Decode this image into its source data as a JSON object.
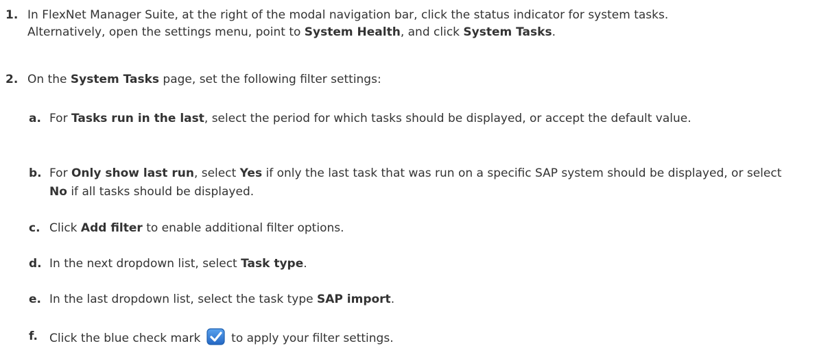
{
  "steps": [
    {
      "number": "1.",
      "line1": "In FlexNet Manager Suite, at the right of the modal navigation bar, click the status indicator for system tasks.",
      "line2_before": "Alternatively, open the settings menu, point to ",
      "system_health": "System Health",
      "line2_middle": ", and click ",
      "system_tasks": "System Tasks",
      "line2_end": "."
    },
    {
      "number": "2.",
      "before": "On the ",
      "system_tasks": "System Tasks",
      "after": " page, set the following filter settings:"
    }
  ],
  "substeps": {
    "a": {
      "letter": "a.",
      "before": "For ",
      "bold1": "Tasks run in the last",
      "after": ", select the period for which tasks should be displayed, or accept the default value."
    },
    "b": {
      "letter": "b.",
      "before": "For ",
      "bold1": "Only show last run",
      "middle1": ", select ",
      "bold2": "Yes",
      "middle2": " if only the last task that was run on a specific SAP system should be displayed, or select ",
      "bold3": "No",
      "after": " if all tasks should be displayed."
    },
    "c": {
      "letter": "c.",
      "before": "Click ",
      "bold1": "Add filter",
      "after": " to enable additional filter options."
    },
    "d": {
      "letter": "d.",
      "before": "In the next dropdown list, select ",
      "bold1": "Task type",
      "after": "."
    },
    "e": {
      "letter": "e.",
      "before": "In the last dropdown list, select the task type ",
      "bold1": "SAP import",
      "after": "."
    },
    "f": {
      "letter": "f.",
      "before": "Click the blue check mark ",
      "icon": "blue-checkmark-icon",
      "after": " to apply your filter settings."
    }
  },
  "colors": {
    "text": "#333333",
    "checkmark_fill": "#2f7fd8",
    "checkmark_border": "#1f5fae"
  }
}
